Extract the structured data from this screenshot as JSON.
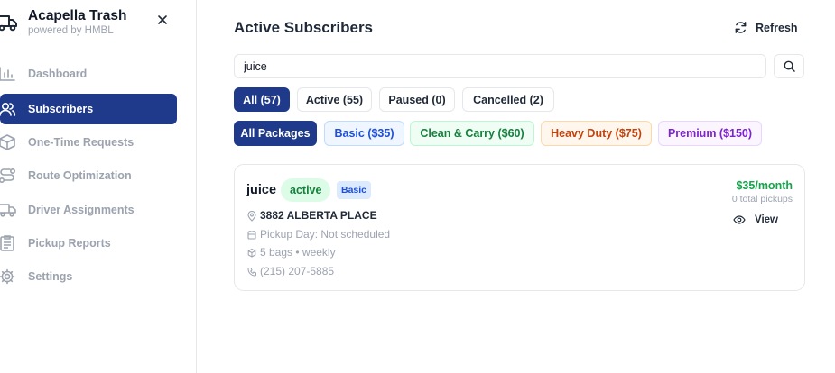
{
  "brand": {
    "title": "Acapella Trash",
    "subtitle": "powered by HMBL"
  },
  "sidebar": {
    "items": [
      {
        "label": "Dashboard",
        "icon": "bar-chart-icon"
      },
      {
        "label": "Subscribers",
        "icon": "users-icon",
        "active": true
      },
      {
        "label": "One-Time Requests",
        "icon": "package-icon"
      },
      {
        "label": "Route Optimization",
        "icon": "route-icon"
      },
      {
        "label": "Driver Assignments",
        "icon": "truck-icon"
      },
      {
        "label": "Pickup Reports",
        "icon": "clipboard-icon"
      },
      {
        "label": "Settings",
        "icon": "gear-icon"
      }
    ]
  },
  "header": {
    "title": "Active Subscribers",
    "refresh_label": "Refresh"
  },
  "search": {
    "value": "juice",
    "placeholder": ""
  },
  "tabs": [
    {
      "label": "All (57)",
      "active": true
    },
    {
      "label": "Active (55)"
    },
    {
      "label": "Paused (0)"
    },
    {
      "label": "Cancelled (2)"
    }
  ],
  "packages": [
    {
      "label": "All Packages",
      "bg": "#1f3a8a",
      "fg": "#ffffff",
      "border": "#1f3a8a"
    },
    {
      "label": "Basic ($35)",
      "bg": "#eff6ff",
      "fg": "#1d4ed8",
      "border": "#bfdbfe"
    },
    {
      "label": "Clean & Carry ($60)",
      "bg": "#f0fdf4",
      "fg": "#15803d",
      "border": "#bbf7d0"
    },
    {
      "label": "Heavy Duty ($75)",
      "bg": "#fff7ed",
      "fg": "#c2410c",
      "border": "#fed7aa"
    },
    {
      "label": "Premium ($150)",
      "bg": "#faf5ff",
      "fg": "#7e22ce",
      "border": "#e9d5ff"
    }
  ],
  "subscriber": {
    "name": "juice",
    "status": "active",
    "plan": "Basic",
    "address": "3882 ALBERTA PLACE",
    "pickup_day": "Pickup Day: Not scheduled",
    "bags": "5 bags • weekly",
    "phone": "(215) 207-5885",
    "price": "$35/month",
    "pickups": "0 total pickups",
    "view_label": "View"
  },
  "colors": {
    "accent": "#1f3a8a",
    "success": "#16a34a"
  }
}
